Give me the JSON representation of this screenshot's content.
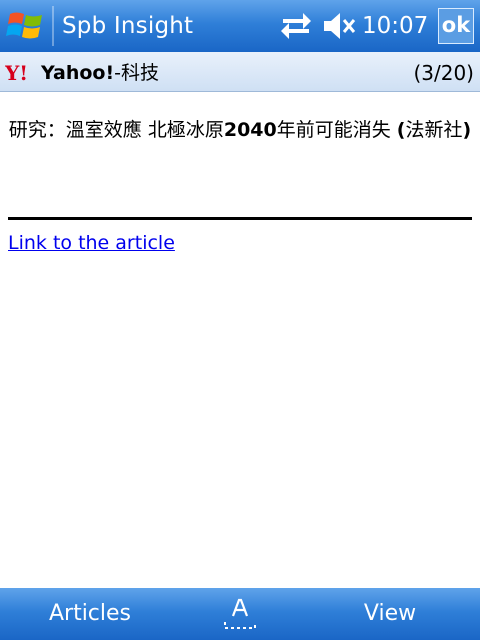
{
  "titlebar": {
    "app_title": "Spb Insight",
    "clock": "10:07",
    "ok_label": "ok"
  },
  "feed": {
    "logo_text": "Y!",
    "name_bold": "Yahoo!",
    "name_rest": "-科技",
    "counter": "(3/20)"
  },
  "article": {
    "title_pre": "研究：溫室效應 北極冰原",
    "title_num": "2040",
    "title_post": "年前可能消失",
    "title_paren_open": "(",
    "title_paren_text": "法新社",
    "title_paren_close": ")",
    "link_text": "Link to the article"
  },
  "menubar": {
    "left_label": "Articles",
    "right_label": "View"
  },
  "colors": {
    "bar_blue": "#2f7fd8",
    "header_bg": "#dbe7f6",
    "link": "#0000ee",
    "yahoo_red": "#d6001c"
  }
}
